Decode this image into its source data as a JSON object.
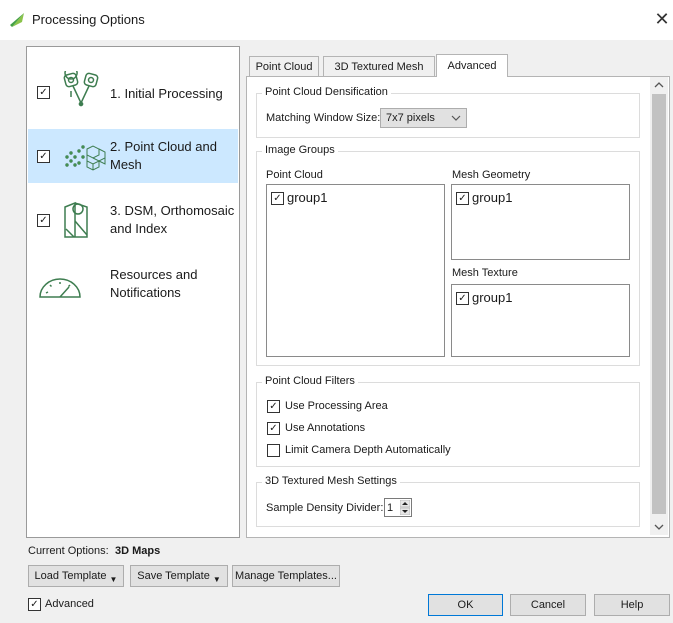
{
  "window": {
    "title": "Processing Options",
    "close_glyph": "✕",
    "icon": "pix4d-leaf-icon"
  },
  "nav": {
    "items": [
      {
        "lines": [
          "1. Initial Processing"
        ],
        "checked": true,
        "selected": false,
        "icon": "initial-processing-icon"
      },
      {
        "lines": [
          "2. Point Cloud and",
          "Mesh"
        ],
        "checked": true,
        "selected": true,
        "icon": "point-cloud-icon"
      },
      {
        "lines": [
          "3. DSM, Orthomosaic",
          "and Index"
        ],
        "checked": true,
        "selected": false,
        "icon": "map-icon"
      },
      {
        "lines": [
          "Resources and",
          "Notifications"
        ],
        "checked": false,
        "selected": false,
        "icon": "gauge-icon"
      }
    ]
  },
  "tabs": [
    {
      "label": "Point Cloud",
      "active": false
    },
    {
      "label": "3D Textured Mesh",
      "active": false
    },
    {
      "label": "Advanced",
      "active": true
    }
  ],
  "densification": {
    "title": "Point Cloud Densification",
    "matching_label": "Matching Window Size:",
    "matching_value": "7x7 pixels"
  },
  "image_groups": {
    "title": "Image Groups",
    "point_cloud_label": "Point Cloud",
    "point_cloud_items": [
      {
        "label": "group1",
        "checked": true
      }
    ],
    "mesh_geometry_label": "Mesh Geometry",
    "mesh_geometry_items": [
      {
        "label": "group1",
        "checked": true
      }
    ],
    "mesh_texture_label": "Mesh Texture",
    "mesh_texture_items": [
      {
        "label": "group1",
        "checked": true
      }
    ]
  },
  "filters": {
    "title": "Point Cloud Filters",
    "options": [
      {
        "label": "Use Processing Area",
        "checked": true
      },
      {
        "label": "Use Annotations",
        "checked": true
      },
      {
        "label": "Limit Camera Depth Automatically",
        "checked": false
      }
    ]
  },
  "mesh_settings": {
    "title": "3D Textured Mesh Settings",
    "sample_label": "Sample Density Divider:",
    "sample_value": "1"
  },
  "footer": {
    "current_options_label": "Current Options:",
    "current_options_value": "3D Maps",
    "load_template": "Load Template",
    "save_template": "Save Template",
    "manage_templates": "Manage Templates...",
    "advanced_label": "Advanced",
    "advanced_checked": true,
    "ok": "OK",
    "cancel": "Cancel",
    "help": "Help"
  },
  "colors": {
    "nav_selected": "#cce8ff",
    "accent_green": "#4caf50",
    "primary_border": "#0078d7",
    "icon_stroke": "#3e7d50"
  }
}
